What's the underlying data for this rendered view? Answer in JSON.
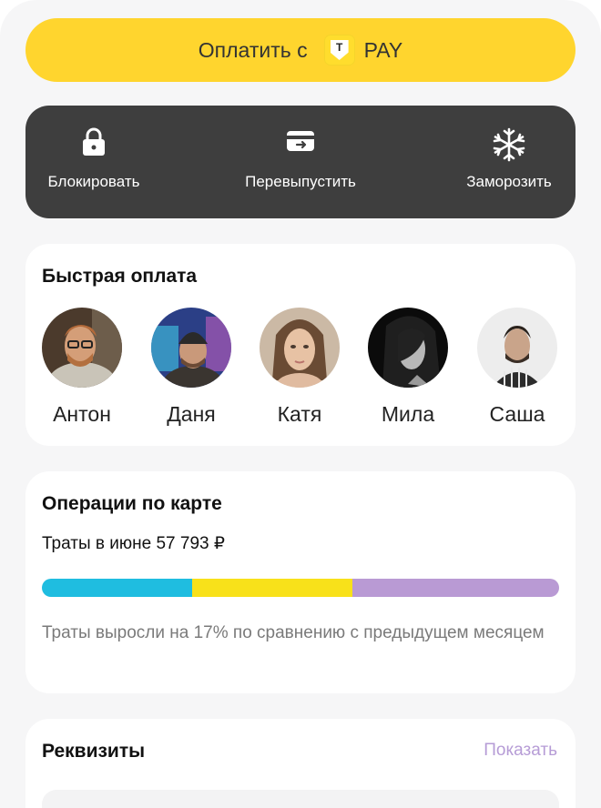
{
  "pay_button": {
    "label": "Оплатить с",
    "logo_letter": "T",
    "pay_text": "PAY"
  },
  "card_actions": [
    {
      "label": "Блокировать",
      "icon": "lock-icon"
    },
    {
      "label": "Перевыпустить",
      "icon": "card-reissue-icon"
    },
    {
      "label": "Заморозить",
      "icon": "snowflake-icon"
    }
  ],
  "quick_pay": {
    "title": "Быстрая оплата",
    "contacts": [
      {
        "name": "Антон"
      },
      {
        "name": "Даня"
      },
      {
        "name": "Катя"
      },
      {
        "name": "Мила"
      },
      {
        "name": "Саша"
      }
    ]
  },
  "operations": {
    "title": "Операции по карте",
    "spending": "Траты в июне 57 793 ₽",
    "segments": [
      {
        "color": "#1fbde0",
        "share": 0.29
      },
      {
        "color": "#f8e11a",
        "share": 0.31
      },
      {
        "color": "#b99ad4",
        "share": 0.4
      }
    ],
    "note": "Траты выросли на 17% по сравнению с предыдущем месяцем"
  },
  "requisites": {
    "title": "Реквизиты",
    "show_label": "Показать"
  },
  "colors": {
    "accent_yellow": "#ffd52e",
    "dark_panel": "#3e3e3e",
    "link_purple": "#b69cd6"
  }
}
